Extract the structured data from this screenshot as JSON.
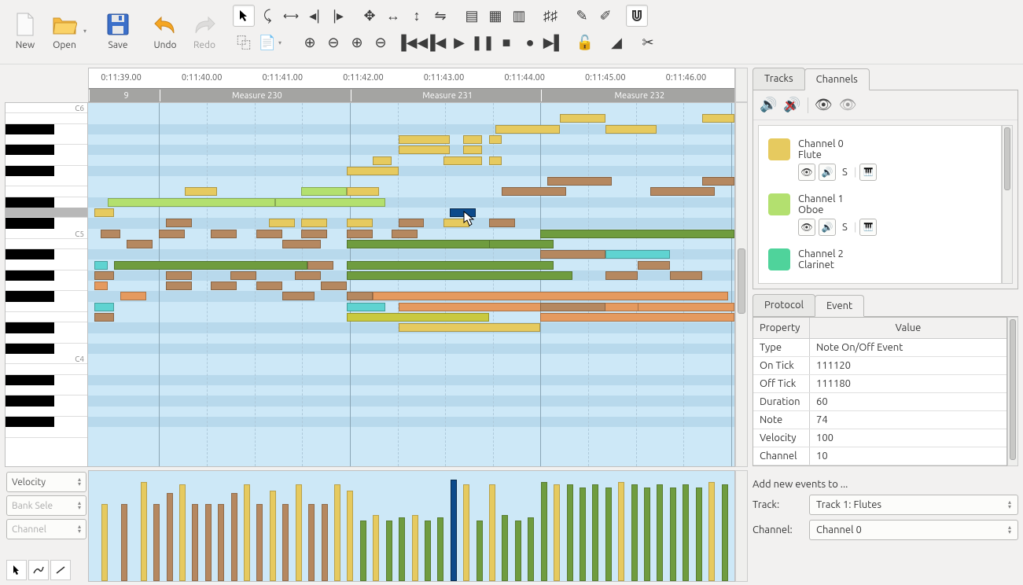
{
  "toolbar": {
    "new": "New",
    "open": "Open",
    "save": "Save",
    "undo": "Undo",
    "redo": "Redo"
  },
  "timeline": {
    "times": [
      "0:11:39.00",
      "0:11:40.00",
      "0:11:41.00",
      "0:11:42.00",
      "0:11:43.00",
      "0:11:44.00",
      "0:11:45.00",
      "0:11:46.00"
    ],
    "measures": [
      "9",
      "Measure 230",
      "Measure 231",
      "Measure 232"
    ]
  },
  "piano_labels": {
    "c4": "C4",
    "c5": "C5",
    "c6": "C6"
  },
  "velocity": {
    "selects": [
      "Velocity",
      "Bank Sele",
      "Channel"
    ]
  },
  "tabs": {
    "tracks": "Tracks",
    "channels": "Channels",
    "protocol": "Protocol",
    "event": "Event"
  },
  "channels": [
    {
      "name": "Channel 0",
      "instrument": "Flute",
      "color": "#e6ca5f"
    },
    {
      "name": "Channel 1",
      "instrument": "Oboe",
      "color": "#b3e06f"
    },
    {
      "name": "Channel 2",
      "instrument": "Clarinet",
      "color": "#4fd39b"
    }
  ],
  "event_table": {
    "header": {
      "prop": "Property",
      "val": "Value"
    },
    "rows": [
      {
        "k": "Type",
        "v": "Note On/Off Event"
      },
      {
        "k": "On Tick",
        "v": "111120"
      },
      {
        "k": "Off Tick",
        "v": "111180"
      },
      {
        "k": "Duration",
        "v": "60"
      },
      {
        "k": "Note",
        "v": "74"
      },
      {
        "k": "Velocity",
        "v": "100"
      },
      {
        "k": "Channel",
        "v": "10"
      }
    ]
  },
  "bottom": {
    "add_label": "Add new events to ...",
    "track_label": "Track:",
    "track_value": "Track 1: Flutes",
    "channel_label": "Channel:",
    "channel_value": "Channel 0"
  },
  "solo_label": "S"
}
